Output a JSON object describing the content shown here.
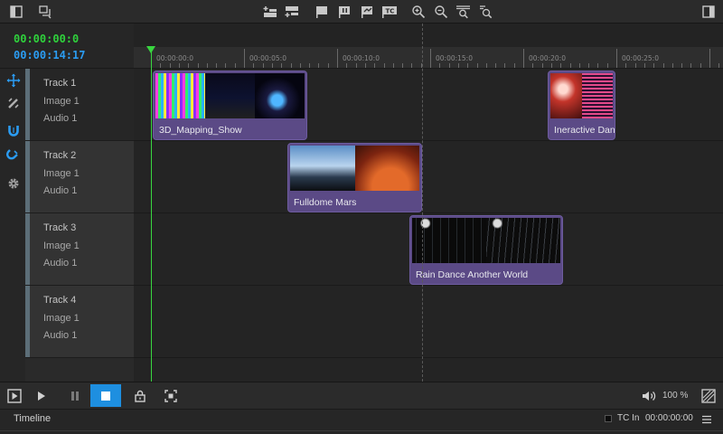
{
  "timecodes": {
    "current": "00:00:00:0",
    "duration": "00:00:14:17"
  },
  "ruler": {
    "ticks": [
      "00:00:00:0",
      "00:00:05:0",
      "00:00:10:0",
      "00:00:15:0",
      "00:00:20:0",
      "00:00:25:0"
    ]
  },
  "tracks": [
    {
      "name": "Track 1",
      "image": "Image 1",
      "audio": "Audio 1"
    },
    {
      "name": "Track 2",
      "image": "Image 1",
      "audio": "Audio 1"
    },
    {
      "name": "Track 3",
      "image": "Image 1",
      "audio": "Audio 1"
    },
    {
      "name": "Track 4",
      "image": "Image 1",
      "audio": "Audio 1"
    }
  ],
  "clips": [
    {
      "label": "3D_Mapping_Show"
    },
    {
      "label": "Ineractive Dan"
    },
    {
      "label": "Fulldome Mars"
    },
    {
      "label": "Rain Dance Another World"
    }
  ],
  "controls": {
    "volume": "100 %"
  },
  "status": {
    "tab": "Timeline",
    "tc_in_label": "TC In",
    "tc_in_value": "00:00:00:00"
  },
  "icons": {
    "toolbar_left": [
      "panel-left-icon",
      "layers-icon"
    ],
    "toolbar_center": [
      "add-track-above-icon",
      "add-track-below-icon",
      "flag-icon",
      "pause-marker-icon",
      "jump-marker-icon",
      "tc-marker-icon",
      "zoom-in-icon",
      "zoom-out-icon",
      "zoom-fit-icon",
      "zoom-reset-icon"
    ],
    "toolbar_right": [
      "panel-right-icon"
    ],
    "tools": [
      "move-icon",
      "trim-icon",
      "magnet-icon",
      "snap-icon",
      "settings-icon"
    ]
  },
  "colors": {
    "accent_blue": "#1e8fe0",
    "timecode_green": "#2fd13c",
    "timecode_blue": "#2b9cf2",
    "clip_purple": "#5b4a86"
  }
}
